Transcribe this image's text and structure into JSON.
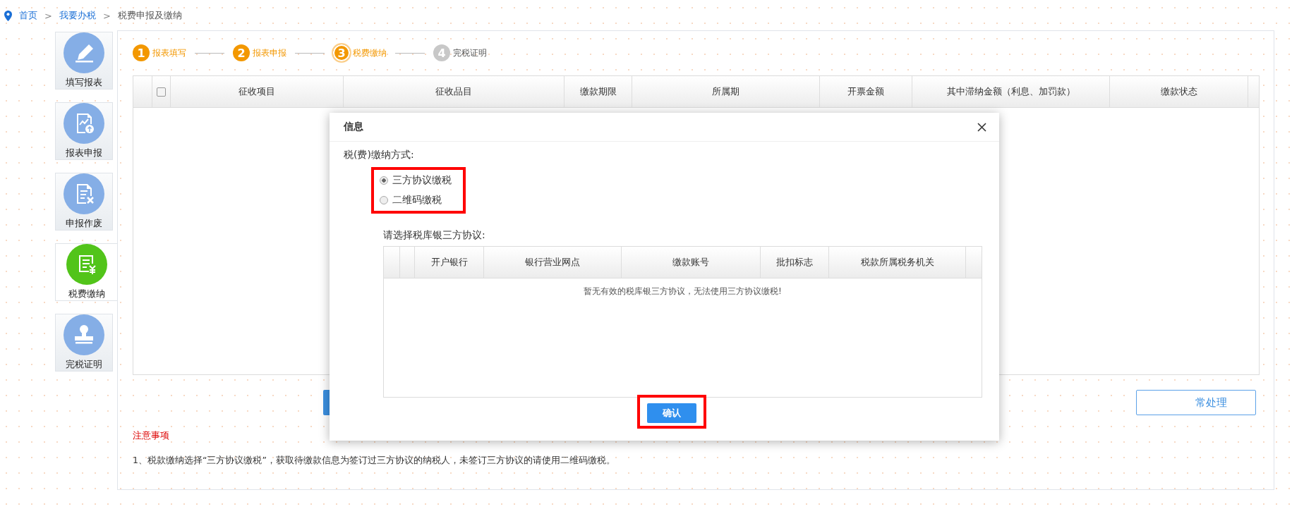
{
  "breadcrumb": [
    {
      "label": "首页",
      "link": true
    },
    {
      "separator": ">",
      "label": "我要办税",
      "link": true
    },
    {
      "separator": ">",
      "label": "税费申报及缴纳",
      "link": false
    }
  ],
  "sidebar": {
    "items": [
      {
        "label": "填写报表",
        "selected": false
      },
      {
        "label": "报表申报",
        "selected": false
      },
      {
        "label": "申报作废",
        "selected": false
      },
      {
        "label": "税费缴纳",
        "selected": true
      },
      {
        "label": "完税证明",
        "selected": false
      }
    ]
  },
  "steps": [
    {
      "number": "1",
      "label": "报表填写",
      "completed": true,
      "selected": false
    },
    {
      "number": "2",
      "label": "报表申报",
      "completed": true,
      "selected": false
    },
    {
      "number": "3",
      "label": "税费缴纳",
      "completed": true,
      "selected": true
    },
    {
      "number": "4",
      "label": "完税证明",
      "completed": false,
      "selected": false
    }
  ],
  "table": {
    "select_all": {
      "checked": false
    },
    "columns": [
      "征收项目",
      "征收品目",
      "缴款期限",
      "所属期",
      "开票金额",
      "其中滞纳金额（利息、加罚款）",
      "缴款状态"
    ]
  },
  "action_buttons": [
    {
      "kind": "primary"
    },
    {
      "kind": "outline",
      "label": "常处理"
    }
  ],
  "notes": {
    "title": "注意事项",
    "items": [
      "1、税款缴纳选择“三方协议缴税”，获取待缴款信息为签订过三方协议的纳税人，未签订三方协议的请使用二维码缴税。"
    ]
  },
  "dialog": {
    "title": "信息",
    "method_label": "税(费)缴纳方式:",
    "methods_highlighted": true,
    "methods": [
      {
        "label": "三方协议缴税",
        "selected": true
      },
      {
        "label": "二维码缴税",
        "selected": false
      }
    ],
    "agreement_label": "请选择税库银三方协议:",
    "agreement_table": {
      "columns": [
        "开户银行",
        "银行营业网点",
        "缴款账号",
        "批扣标志",
        "税款所属税务机关"
      ],
      "empty_message": "暂无有效的税库银三方协议，无法使用三方协议缴税!"
    },
    "confirm": {
      "label": "确认",
      "highlighted": true
    }
  }
}
